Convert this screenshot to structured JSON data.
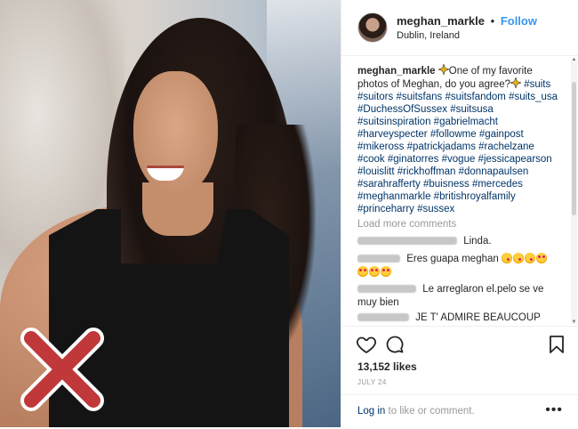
{
  "header": {
    "username": "meghan_markle",
    "separator": "•",
    "follow_label": "Follow",
    "location": "Dublin, Ireland"
  },
  "caption": {
    "username": "meghan_markle",
    "text": "One of my favorite photos of Meghan, do you agree?",
    "hashtags": [
      "#suits",
      "#suitors",
      "#suitsfans",
      "#suitsfandom",
      "#suits_usa",
      "#DuchessOfSussex",
      "#suitsusa",
      "#suitsinspiration",
      "#gabrielmacht",
      "#harveyspecter",
      "#followme",
      "#gainpost",
      "#mikeross",
      "#patrickjadams",
      "#rachelzane",
      "#cook",
      "#ginatorres",
      "#vogue",
      "#jessicapearson",
      "#louislitt",
      "#rickhoffman",
      "#donnapaulsen",
      "#sarahrafferty",
      "#buisness",
      "#mercedes",
      "#meghanmarkle",
      "#britishroyalfamily",
      "#princeharry",
      "#sussex"
    ]
  },
  "load_more": "Load more comments",
  "comments": [
    {
      "text": "Linda."
    },
    {
      "text": "Eres guapa meghan"
    },
    {
      "text": "Le arreglaron el.pelo se ve muy bien"
    },
    {
      "text": "JE T' ADMIRE BEAUCOUP CAR"
    }
  ],
  "likes": "13,152 likes",
  "date": "JULY 24",
  "login": {
    "link": "Log in",
    "rest": " to like or comment."
  },
  "more_label": "•••",
  "colors": {
    "link": "#003569",
    "follow": "#3897f0",
    "x_mark": "#c0383a"
  }
}
